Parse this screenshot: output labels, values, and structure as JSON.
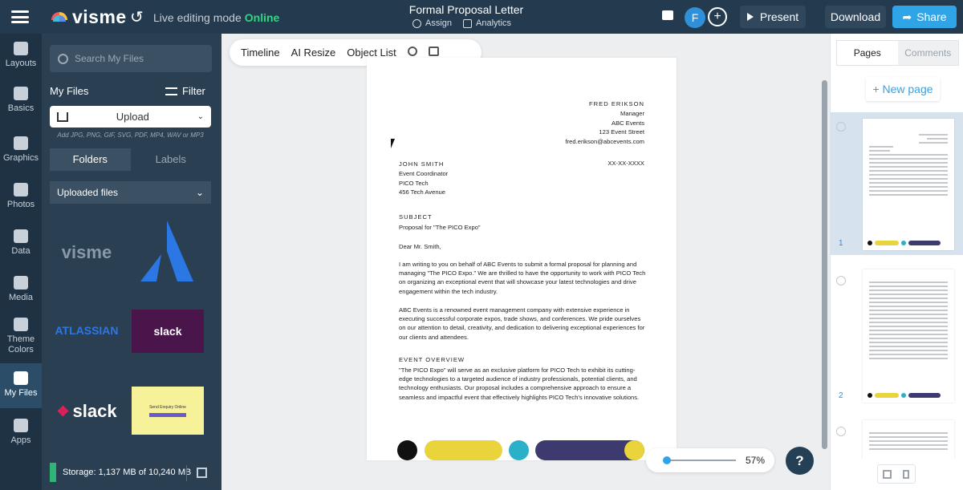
{
  "app": {
    "logo_text": "visme",
    "live_mode_label": "Live editing mode",
    "live_status": "Online",
    "doc_title": "Formal Proposal Letter",
    "assign_label": "Assign",
    "analytics_label": "Analytics",
    "avatar_initial": "F",
    "present_label": "Present",
    "download_label": "Download",
    "share_label": "Share"
  },
  "rail": {
    "items": [
      {
        "label": "Layouts",
        "icon": "layouts-icon"
      },
      {
        "label": "Basics",
        "icon": "basics-icon"
      },
      {
        "label": "Graphics",
        "icon": "graphics-icon"
      },
      {
        "label": "Photos",
        "icon": "photos-icon"
      },
      {
        "label": "Data",
        "icon": "data-icon"
      },
      {
        "label": "Media",
        "icon": "media-icon"
      },
      {
        "label": "Theme",
        "label2": "Colors",
        "icon": "palette-icon"
      },
      {
        "label": "My Files",
        "icon": "my-files-icon"
      },
      {
        "label": "Apps",
        "icon": "apps-icon"
      }
    ]
  },
  "files_panel": {
    "search_placeholder": "Search My Files",
    "title": "My Files",
    "filter_label": "Filter",
    "upload_label": "Upload",
    "formats": "Add JPG, PNG, GIF, SVG, PDF, MP4, WAV or MP3",
    "tab_folders": "Folders",
    "tab_labels": "Labels",
    "uploaded_label": "Uploaded files",
    "thumbs": {
      "visme": "visme",
      "atlassian": "ATLASSIAN",
      "slack1": "slack",
      "slack2": "slack",
      "email": "Send Enquiry Online"
    },
    "storage": "Storage: 1,137 MB of 10,240 MB"
  },
  "toolbar": {
    "timeline": "Timeline",
    "ai_resize": "AI Resize",
    "object_list": "Object List"
  },
  "letter": {
    "sender_name": "FRED ERIKSON",
    "sender_title": "Manager",
    "sender_company": "ABC Events",
    "sender_address": "123 Event Street",
    "sender_email": "fred.erikson@abcevents.com",
    "recipient_name": "JOHN SMITH",
    "recipient_phone": "XX-XX-XXXX",
    "recipient_title": "Event Coordinator",
    "recipient_company": "PICO Tech",
    "recipient_address": "456 Tech Avenue",
    "subject_heading": "SUBJECT",
    "subject_text": "Proposal for \"The PICO Expo\"",
    "greeting": "Dear Mr. Smith,",
    "para1": "I am writing to you on behalf of ABC Events to submit a formal proposal for planning and managing \"The PICO Expo.\" We are thrilled to have the opportunity to work with PICO Tech on organizing an exceptional event that will showcase your latest technologies and drive engagement within the tech industry.",
    "para2": "ABC Events is a renowned event management company with extensive experience in executing successful corporate expos, trade shows, and conferences. We pride ourselves on our attention to detail, creativity, and dedication to delivering exceptional experiences for our clients and attendees.",
    "overview_heading": "EVENT OVERVIEW",
    "para3": "\"The PICO Expo\" will serve as an exclusive platform for PICO Tech to exhibit its cutting-edge technologies to a targeted audience of industry professionals, potential clients, and technology enthusiasts. Our proposal includes a comprehensive approach to ensure a seamless and impactful event that effectively highlights PICO Tech's innovative solutions."
  },
  "zoom": {
    "value": "57%",
    "level": 0.1
  },
  "help_label": "?",
  "pages_panel": {
    "tab_pages": "Pages",
    "tab_comments": "Comments",
    "new_page": "+ New page",
    "page_numbers": [
      "1",
      "2"
    ]
  },
  "colors": {
    "accent": "#2fa4e7",
    "online": "#32d583",
    "topbar": "#243b4f",
    "yellow": "#e9d43c",
    "teal": "#2bb0c9",
    "navy": "#3c3a6e"
  }
}
